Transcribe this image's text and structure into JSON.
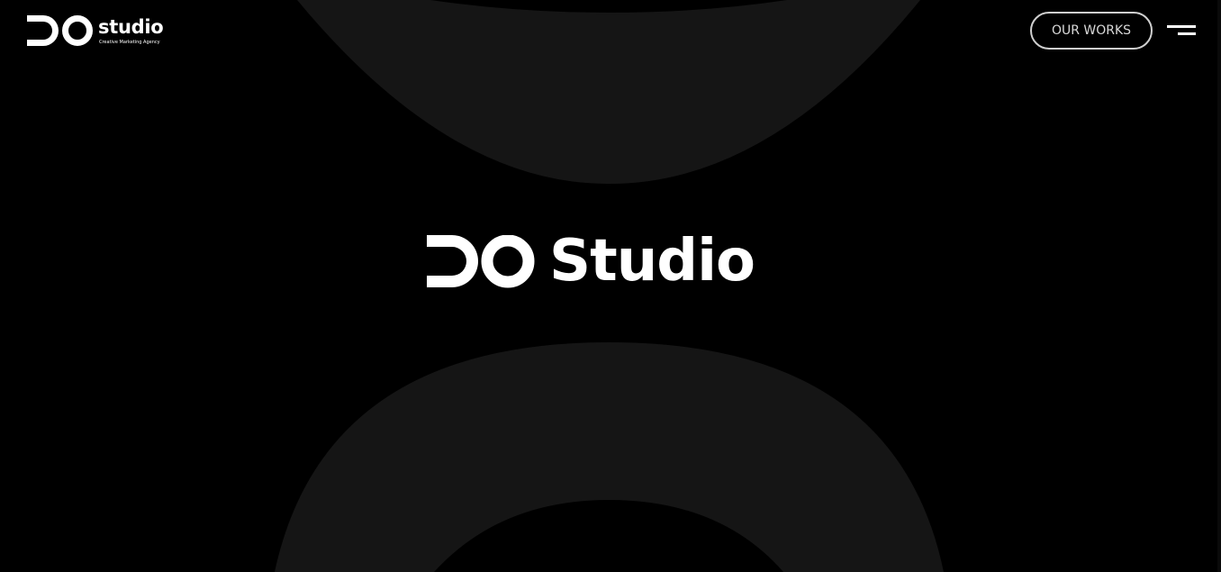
{
  "header": {
    "logo_text": "studio",
    "logo_tagline": "Creative Marketing Agency",
    "our_works_label": "OUR WORKS",
    "menu_icon": "hamburger-menu-icon"
  },
  "hero": {
    "title": "Studio"
  },
  "colors": {
    "background": "#000000",
    "ring": "#151515",
    "text": "#ffffff",
    "button_border": "#cfcfcf"
  }
}
